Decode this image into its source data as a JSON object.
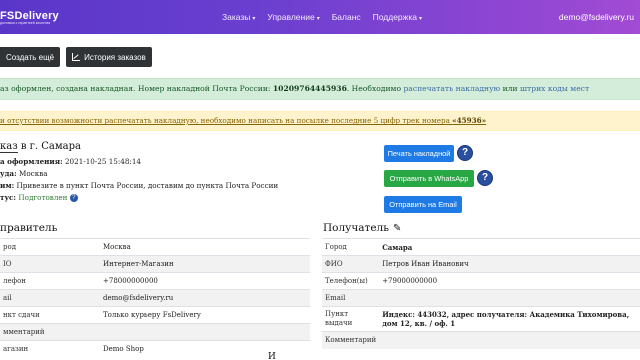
{
  "navbar": {
    "logo": "FSDelivery",
    "logo_sub": "доставка с гарантией качества",
    "items": [
      {
        "label": "Заказы",
        "dropdown": "▾"
      },
      {
        "label": "Управление",
        "dropdown": "▾"
      },
      {
        "label": "Баланс",
        "dropdown": ""
      },
      {
        "label": "Поддержка",
        "dropdown": "▾"
      }
    ],
    "user_email": "demo@fsdelivery.ru",
    "gradient": [
      "#5a36c8",
      "#a24bd4"
    ]
  },
  "toolbar": {
    "create_label": "Создать ещё",
    "history_label": "История заказов",
    "history_icon": "chart-icon"
  },
  "alert_success": {
    "prefix": "аз оформлен, создана накладная. Номер накладной Почта России: ",
    "number": "10209764445936",
    "middle": ". Необходимо ",
    "link1": "распечатать накладную",
    "or": " или ",
    "link2": "штрих коды мест",
    "color": "#d4edda"
  },
  "alert_warning": {
    "text": "и отсутствии возможности распечатать накладную, необходимо написать на посылке последние 5 цифр трек номера ",
    "code": "«45936»",
    "color": "#fff3cd"
  },
  "order": {
    "title_prefix": "каз",
    "title_city": " в г. Самара",
    "meta": [
      {
        "label": "а оформления:",
        "value": " 2021-10-25 15:48:14"
      },
      {
        "label": "уда:",
        "value": " Москва"
      },
      {
        "label": "им:",
        "value": " Привезите в пункт Почта России, доставим до пункта Почта России"
      },
      {
        "label": "тус:",
        "value": " Подготовлен"
      }
    ],
    "help_glyph": "?"
  },
  "actions": {
    "print_label": "Печать накладной",
    "whatsapp_label": "Отправить в WhatsApp",
    "email_label": "Отправить на Email",
    "help_glyph": "?"
  },
  "sender": {
    "title": "правитель",
    "rows": [
      {
        "label": "род",
        "value": "Москва"
      },
      {
        "label": "IO",
        "value": "Интернет-Магазин"
      },
      {
        "label": "лефон",
        "value": "+78000000000"
      },
      {
        "label": "ail",
        "value": "demo@fsdelivery.ru"
      },
      {
        "label": "нкт сдачи",
        "value": "Только курьеру FsDelivery"
      },
      {
        "label": "мментарий",
        "value": ""
      },
      {
        "label": "агазин",
        "value": "Demo Shop"
      }
    ]
  },
  "recipient": {
    "title": "Получатель",
    "edit_icon": "pencil-icon",
    "rows": [
      {
        "label": "Город",
        "value": "Самара"
      },
      {
        "label": "ФИО",
        "value": "Петров Иван Иванович"
      },
      {
        "label": "Телефон(ы)",
        "value": "+79000000000"
      },
      {
        "label": "Email",
        "value": ""
      },
      {
        "label": "Пункт выдачи",
        "value": "Индекс: 443032, адрес получателя: Академика Тихомирова, дом 12, кв. / оф. 1"
      },
      {
        "label": "Комментарий",
        "value": ""
      }
    ]
  },
  "bottom_fragment": "И"
}
